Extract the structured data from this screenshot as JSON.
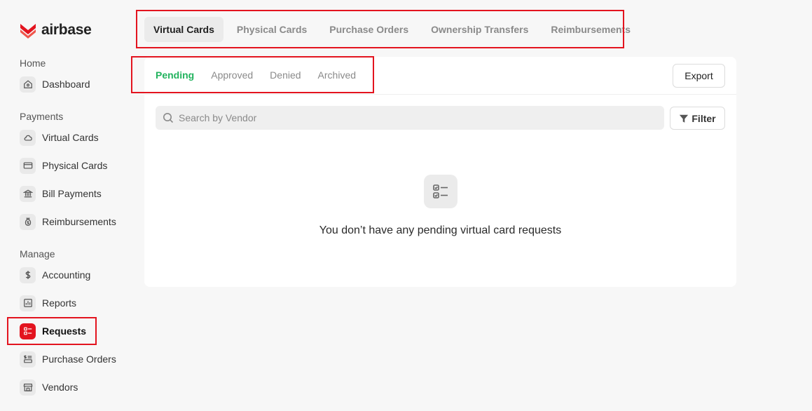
{
  "brand": {
    "name": "airbase",
    "color": "#e3141f"
  },
  "sidebar": {
    "sections": [
      {
        "label": "Home",
        "items": [
          {
            "label": "Dashboard",
            "icon": "home-icon"
          }
        ]
      },
      {
        "label": "Payments",
        "items": [
          {
            "label": "Virtual Cards",
            "icon": "cloud-icon"
          },
          {
            "label": "Physical Cards",
            "icon": "credit-card-icon"
          },
          {
            "label": "Bill Payments",
            "icon": "bank-icon"
          },
          {
            "label": "Reimbursements",
            "icon": "money-bag-icon"
          }
        ]
      },
      {
        "label": "Manage",
        "items": [
          {
            "label": "Accounting",
            "icon": "dollar-icon"
          },
          {
            "label": "Reports",
            "icon": "bar-chart-icon"
          },
          {
            "label": "Requests",
            "icon": "checklist-icon",
            "active": true
          },
          {
            "label": "Purchase Orders",
            "icon": "purchase-order-icon"
          },
          {
            "label": "Vendors",
            "icon": "storefront-icon"
          }
        ]
      }
    ]
  },
  "top_tabs": [
    {
      "label": "Virtual Cards",
      "active": true
    },
    {
      "label": "Physical Cards"
    },
    {
      "label": "Purchase Orders"
    },
    {
      "label": "Ownership Transfers"
    },
    {
      "label": "Reimbursements"
    }
  ],
  "sub_tabs": [
    {
      "label": "Pending",
      "active": true
    },
    {
      "label": "Approved"
    },
    {
      "label": "Denied"
    },
    {
      "label": "Archived"
    }
  ],
  "export_label": "Export",
  "search": {
    "placeholder": "Search by Vendor",
    "value": ""
  },
  "filter_label": "Filter",
  "empty_state": {
    "icon": "checklist-icon",
    "message": "You don’t have any pending virtual card requests"
  },
  "colors": {
    "accent": "#e3141f",
    "active_subtab": "#22b35e",
    "annotation": "#e3141f"
  }
}
